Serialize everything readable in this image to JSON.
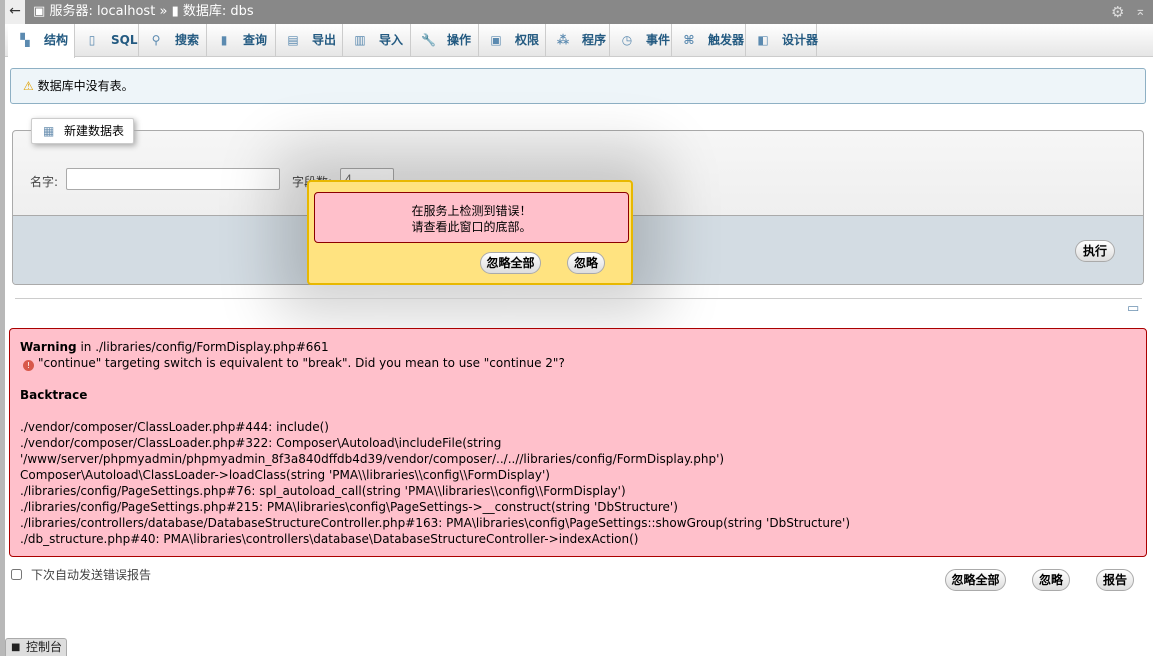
{
  "titlebar": {
    "back": "←",
    "server_label": "服务器: localhost",
    "sep": "»",
    "db_label": "数据库: dbs"
  },
  "tabs": [
    {
      "label": "结构",
      "icon": "structure-icon",
      "active": true
    },
    {
      "label": "SQL",
      "icon": "sql-icon"
    },
    {
      "label": "搜索",
      "icon": "search-icon"
    },
    {
      "label": "查询",
      "icon": "query-icon"
    },
    {
      "label": "导出",
      "icon": "export-icon"
    },
    {
      "label": "导入",
      "icon": "import-icon"
    },
    {
      "label": "操作",
      "icon": "wrench-icon"
    },
    {
      "label": "权限",
      "icon": "privileges-icon"
    },
    {
      "label": "程序",
      "icon": "routines-icon"
    },
    {
      "label": "事件",
      "icon": "clock-icon"
    },
    {
      "label": "触发器",
      "icon": "triggers-icon"
    },
    {
      "label": "设计器",
      "icon": "designer-icon"
    }
  ],
  "notice": "数据库中没有表。",
  "create_table": {
    "legend": "新建数据表",
    "name_label": "名字:",
    "name_value": "",
    "fields_label": "字段数:",
    "fields_value": "4",
    "go": "执行"
  },
  "modal": {
    "line1": "在服务上检测到错误！",
    "line2": "请查看此窗口的底部。",
    "ignore_all": "忽略全部",
    "ignore": "忽略"
  },
  "error": {
    "heading": "Warning",
    "location": " in ./libraries/config/FormDisplay.php#661",
    "message": "\"continue\" targeting switch is equivalent to \"break\". Did you mean to use \"continue 2\"?",
    "backtrace_title": "Backtrace",
    "backtrace": [
      "./vendor/composer/ClassLoader.php#444: include()",
      "./vendor/composer/ClassLoader.php#322: Composer\\Autoload\\includeFile(string",
      "'/www/server/phpmyadmin/phpmyadmin_8f3a840dffdb4d39/vendor/composer/../..//libraries/config/FormDisplay.php')",
      "Composer\\Autoload\\ClassLoader->loadClass(string 'PMA\\\\libraries\\\\config\\\\FormDisplay')",
      "./libraries/config/PageSettings.php#76: spl_autoload_call(string 'PMA\\\\libraries\\\\config\\\\FormDisplay')",
      "./libraries/config/PageSettings.php#215: PMA\\libraries\\config\\PageSettings->__construct(string 'DbStructure')",
      "./libraries/controllers/database/DatabaseStructureController.php#163: PMA\\libraries\\config\\PageSettings::showGroup(string 'DbStructure')",
      "./db_structure.php#40: PMA\\libraries\\controllers\\database\\DatabaseStructureController->indexAction()"
    ]
  },
  "report": {
    "auto_send_label": "下次自动发送错误报告",
    "ignore_all": "忽略全部",
    "ignore": "忽略",
    "report": "报告"
  },
  "console": "控制台"
}
